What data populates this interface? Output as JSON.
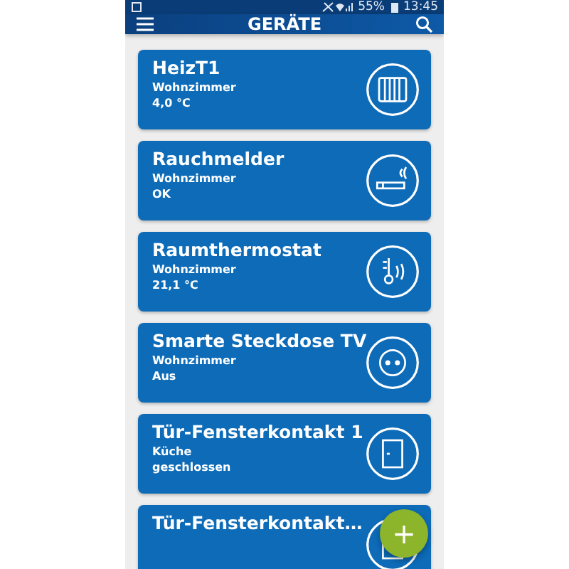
{
  "status_bar": {
    "battery": "55%",
    "time": "13:45"
  },
  "app_bar": {
    "title": "GERÄTE"
  },
  "devices": [
    {
      "name": "HeizT1",
      "room": "Wohnzimmer",
      "state": "4,0 °C",
      "kind": "radiator"
    },
    {
      "name": "Rauchmelder",
      "room": "Wohnzimmer",
      "state": "OK",
      "kind": "smoke"
    },
    {
      "name": "Raumthermostat",
      "room": "Wohnzimmer",
      "state": "21,1 °C",
      "kind": "thermostat"
    },
    {
      "name": "Smarte Steckdose TV",
      "room": "Wohnzimmer",
      "state": "Aus",
      "kind": "socket"
    },
    {
      "name": "Tür-Fensterkontakt 1",
      "room": "Küche",
      "state": "geschlossen",
      "kind": "door"
    },
    {
      "name": "Tür-Fensterkontakt…",
      "kind": "door"
    }
  ],
  "fab": {
    "label": "+"
  }
}
